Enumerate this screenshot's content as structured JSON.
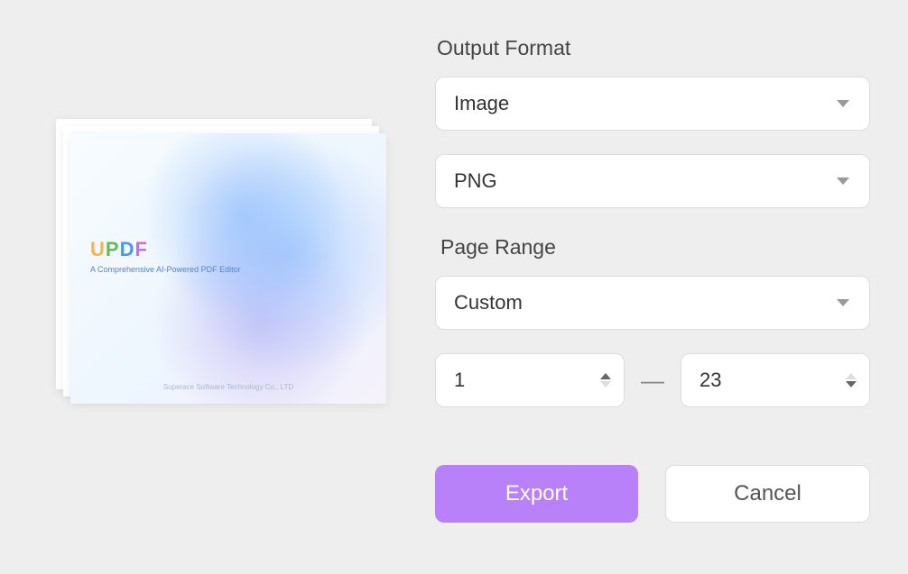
{
  "preview": {
    "logo_letters": [
      "U",
      "P",
      "D",
      "F"
    ],
    "logo_subtitle": "A Comprehensive AI-Powered PDF Editor",
    "footer": "Superace Software Technology Co., LTD"
  },
  "form": {
    "output_format_label": "Output Format",
    "format_type": "Image",
    "image_format": "PNG",
    "page_range_label": "Page Range",
    "page_range_mode": "Custom",
    "page_from": "1",
    "page_to": "23",
    "range_separator": "—"
  },
  "buttons": {
    "export": "Export",
    "cancel": "Cancel"
  }
}
